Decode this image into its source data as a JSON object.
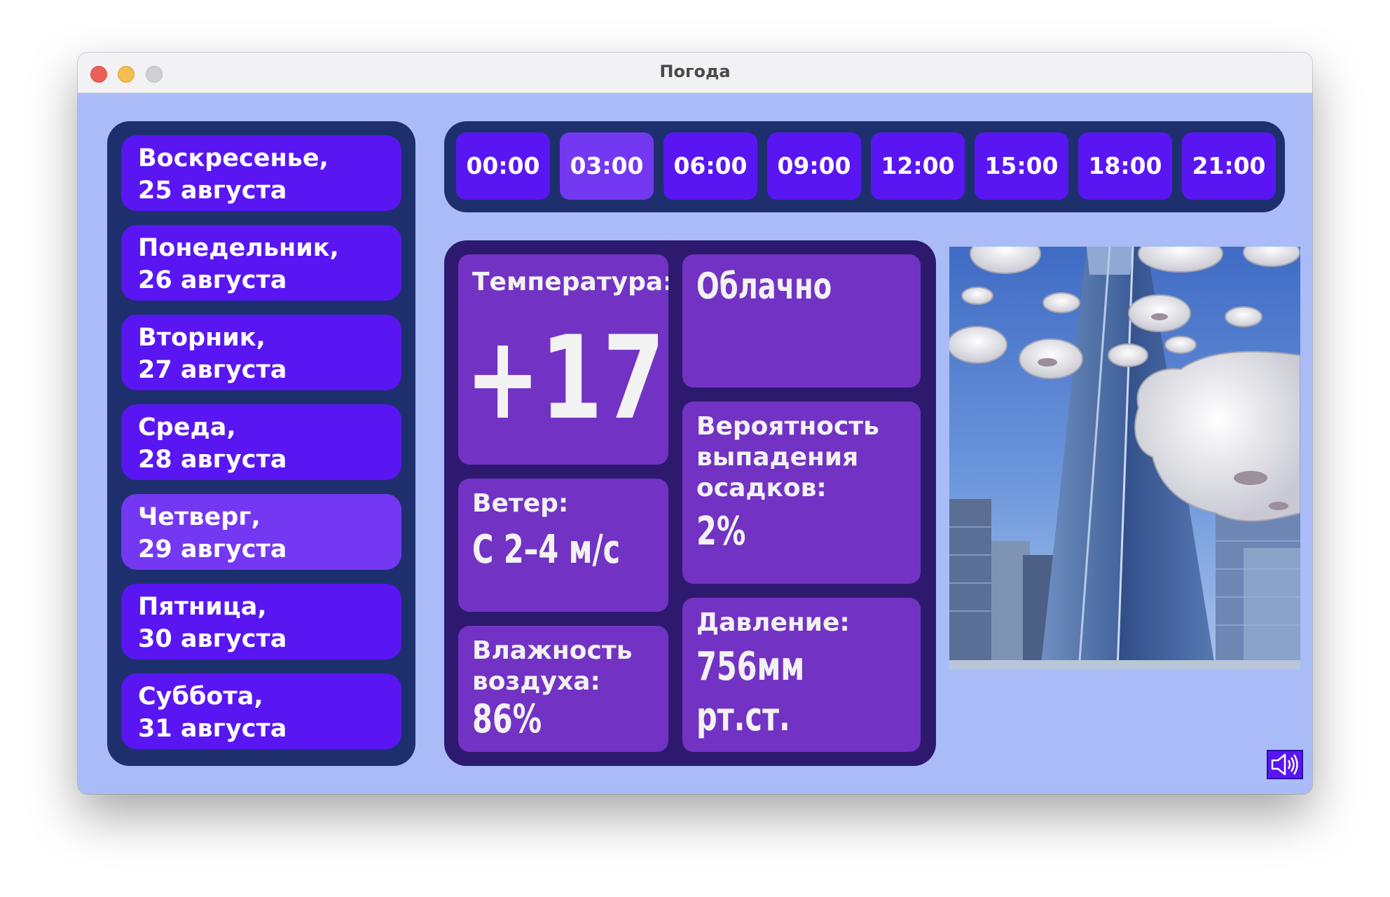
{
  "window": {
    "title": "Погода"
  },
  "days": [
    {
      "line1": "Воскресенье,",
      "line2": "25 августа",
      "selected": false
    },
    {
      "line1": "Понедельник,",
      "line2": "26 августа",
      "selected": false
    },
    {
      "line1": "Вторник,",
      "line2": "27 августа",
      "selected": false
    },
    {
      "line1": "Среда,",
      "line2": "28 августа",
      "selected": false
    },
    {
      "line1": "Четверг,",
      "line2": "29 августа",
      "selected": true
    },
    {
      "line1": "Пятница,",
      "line2": "30 августа",
      "selected": false
    },
    {
      "line1": "Суббота,",
      "line2": "31 августа",
      "selected": false
    }
  ],
  "hours": [
    {
      "label": "00:00",
      "selected": false
    },
    {
      "label": "03:00",
      "selected": true
    },
    {
      "label": "06:00",
      "selected": false
    },
    {
      "label": "09:00",
      "selected": false
    },
    {
      "label": "12:00",
      "selected": false
    },
    {
      "label": "15:00",
      "selected": false
    },
    {
      "label": "18:00",
      "selected": false
    },
    {
      "label": "21:00",
      "selected": false
    }
  ],
  "weather": {
    "temperature": {
      "label": "Температура:",
      "value": "+17"
    },
    "condition": {
      "value": "Облачно"
    },
    "wind": {
      "label": "Ветер:",
      "value": "С 2–4 м/с"
    },
    "precipitation": {
      "label_line1": "Вероятность",
      "label_line2": "выпадения",
      "label_line3": "осадков:",
      "value": "2%"
    },
    "humidity": {
      "label_line1": "Влажность",
      "label_line2": "воздуха:",
      "value": "86%"
    },
    "pressure": {
      "label": "Давление:",
      "value_line1": "756мм",
      "value_line2": "рт.ст."
    }
  },
  "image": {
    "subject": "city-skyscraper-with-cat-clouds"
  },
  "controls": {
    "sound_icon": "speaker-icon"
  },
  "colors": {
    "background": "#a9bcf8",
    "panel": "#1e2f6e",
    "details_panel": "#2d1a6e",
    "item": "#5916f2",
    "item_selected": "#7438f2",
    "card": "#7233c4"
  }
}
